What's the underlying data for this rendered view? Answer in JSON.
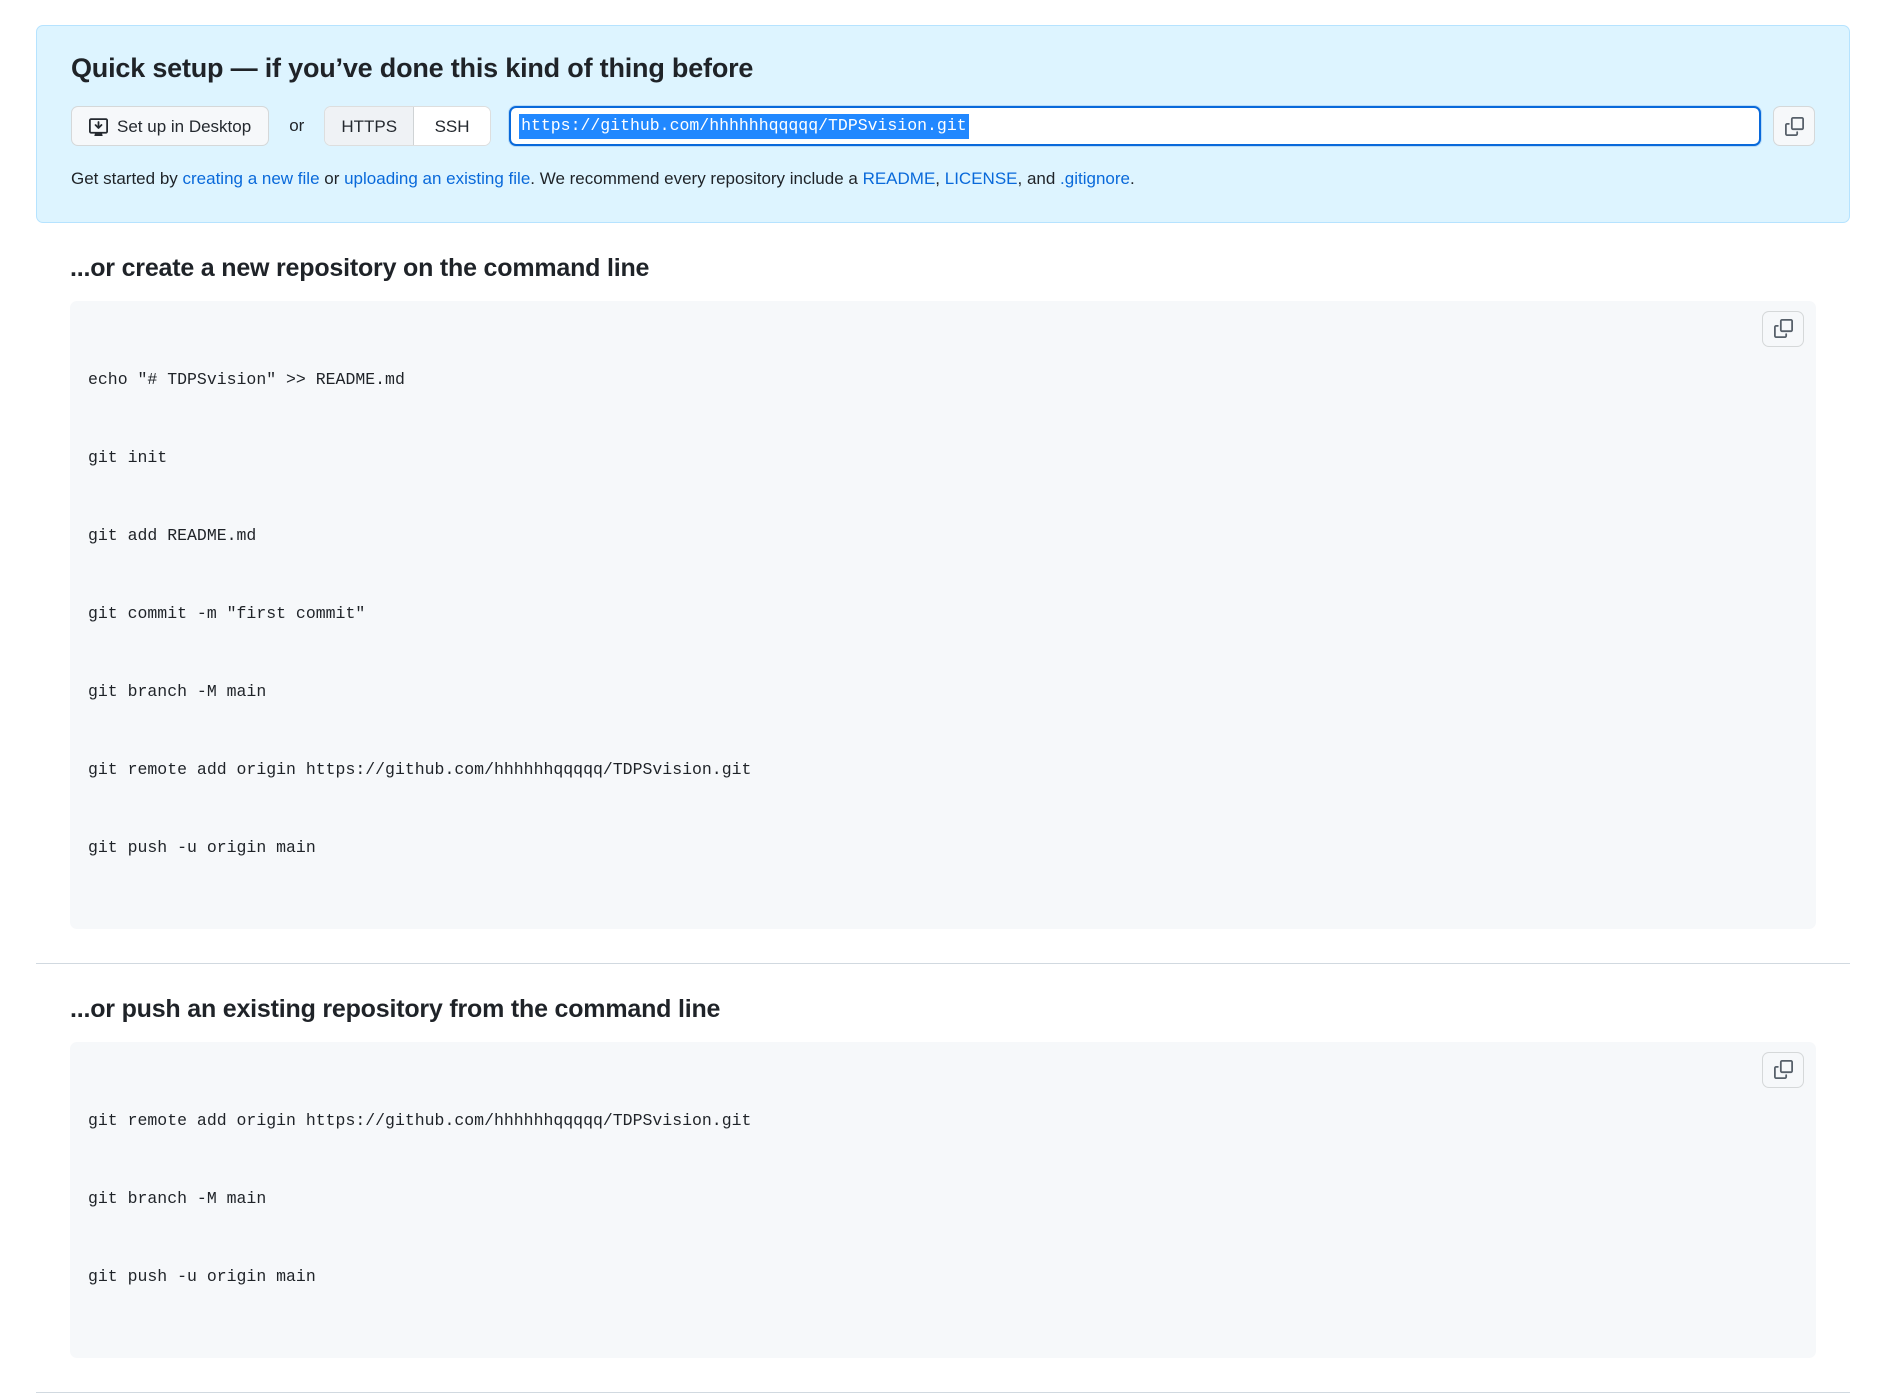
{
  "quick_setup": {
    "heading": "Quick setup — if you’ve done this kind of thing before",
    "desktop_button_label": "Set up in Desktop",
    "desktop_icon": "desktop-download-icon",
    "or_label": "or",
    "protocols": [
      {
        "label": "HTTPS",
        "selected": true
      },
      {
        "label": "SSH",
        "selected": false
      }
    ],
    "clone_url": "https://github.com/hhhhhhqqqqq/TDPSvision.git",
    "clone_url_selected": true,
    "copy_icon": "copy-icon",
    "copy_button_label": "Copy url to clipboard",
    "help": {
      "prefix": "Get started by ",
      "link_create": "creating a new file",
      "mid1": " or ",
      "link_upload": "uploading an existing file",
      "mid2": ". We recommend every repository include a ",
      "link_readme": "README",
      "mid3": ", ",
      "link_license": "LICENSE",
      "mid4": ", and ",
      "link_gitignore": ".gitignore",
      "suffix": "."
    }
  },
  "create_section": {
    "heading": "...or create a new repository on the command line",
    "copy_icon": "copy-icon",
    "copy_button_label": "Copy to clipboard",
    "lines": [
      "echo \"# TDPSvision\" >> README.md",
      "git init",
      "git add README.md",
      "git commit -m \"first commit\"",
      "git branch -M main",
      "git remote add origin https://github.com/hhhhhhqqqqq/TDPSvision.git",
      "git push -u origin main"
    ]
  },
  "push_section": {
    "heading": "...or push an existing repository from the command line",
    "copy_icon": "copy-icon",
    "copy_button_label": "Copy to clipboard",
    "lines": [
      "git remote add origin https://github.com/hhhhhhqqqqq/TDPSvision.git",
      "git branch -M main",
      "git push -u origin main"
    ]
  },
  "colors": {
    "banner_bg": "#ddf4ff",
    "banner_border": "#b6e3ff",
    "link": "#0969da",
    "selection": "#2188ff",
    "code_bg": "#f6f8fa",
    "text": "#1f2328"
  }
}
